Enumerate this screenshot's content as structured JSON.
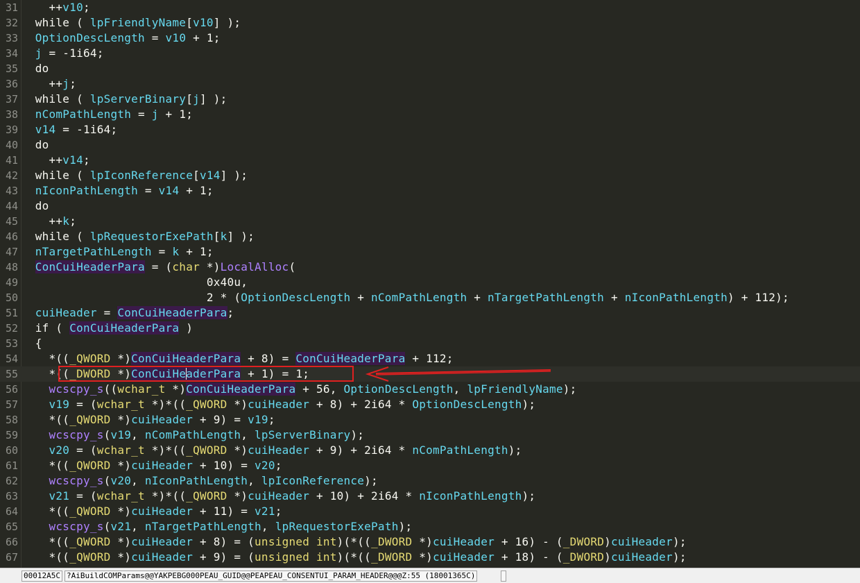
{
  "editor": {
    "lines": [
      {
        "n": "31",
        "tokens": [
          [
            "    ",
            "p"
          ],
          [
            "++",
            "p"
          ],
          [
            "v10",
            "v"
          ],
          [
            ";",
            "p"
          ]
        ]
      },
      {
        "n": "32",
        "tokens": [
          [
            "  while ( ",
            "p"
          ],
          [
            "lpFriendlyName",
            "v"
          ],
          [
            "[",
            "p"
          ],
          [
            "v10",
            "v"
          ],
          [
            "] );",
            "p"
          ]
        ]
      },
      {
        "n": "33",
        "tokens": [
          [
            "  ",
            "p"
          ],
          [
            "OptionDescLength",
            "v"
          ],
          [
            " = ",
            "p"
          ],
          [
            "v10",
            "v"
          ],
          [
            " + 1;",
            "p"
          ]
        ]
      },
      {
        "n": "34",
        "tokens": [
          [
            "  ",
            "p"
          ],
          [
            "j",
            "v"
          ],
          [
            " = -1i64;",
            "p"
          ]
        ]
      },
      {
        "n": "35",
        "tokens": [
          [
            "  do",
            "p"
          ]
        ]
      },
      {
        "n": "36",
        "tokens": [
          [
            "    ++",
            "p"
          ],
          [
            "j",
            "v"
          ],
          [
            ";",
            "p"
          ]
        ]
      },
      {
        "n": "37",
        "tokens": [
          [
            "  while ( ",
            "p"
          ],
          [
            "lpServerBinary",
            "v"
          ],
          [
            "[",
            "p"
          ],
          [
            "j",
            "v"
          ],
          [
            "] );",
            "p"
          ]
        ]
      },
      {
        "n": "38",
        "tokens": [
          [
            "  ",
            "p"
          ],
          [
            "nComPathLength",
            "v"
          ],
          [
            " = ",
            "p"
          ],
          [
            "j",
            "v"
          ],
          [
            " + 1;",
            "p"
          ]
        ]
      },
      {
        "n": "39",
        "tokens": [
          [
            "  ",
            "p"
          ],
          [
            "v14",
            "v"
          ],
          [
            " = -1i64;",
            "p"
          ]
        ]
      },
      {
        "n": "40",
        "tokens": [
          [
            "  do",
            "p"
          ]
        ]
      },
      {
        "n": "41",
        "tokens": [
          [
            "    ++",
            "p"
          ],
          [
            "v14",
            "v"
          ],
          [
            ";",
            "p"
          ]
        ]
      },
      {
        "n": "42",
        "tokens": [
          [
            "  while ( ",
            "p"
          ],
          [
            "lpIconReference",
            "v"
          ],
          [
            "[",
            "p"
          ],
          [
            "v14",
            "v"
          ],
          [
            "] );",
            "p"
          ]
        ]
      },
      {
        "n": "43",
        "tokens": [
          [
            "  ",
            "p"
          ],
          [
            "nIconPathLength",
            "v"
          ],
          [
            " = ",
            "p"
          ],
          [
            "v14",
            "v"
          ],
          [
            " + 1;",
            "p"
          ]
        ]
      },
      {
        "n": "44",
        "tokens": [
          [
            "  do",
            "p"
          ]
        ]
      },
      {
        "n": "45",
        "tokens": [
          [
            "    ++",
            "p"
          ],
          [
            "k",
            "v"
          ],
          [
            ";",
            "p"
          ]
        ]
      },
      {
        "n": "46",
        "tokens": [
          [
            "  while ( ",
            "p"
          ],
          [
            "lpRequestorExePath",
            "v"
          ],
          [
            "[",
            "p"
          ],
          [
            "k",
            "v"
          ],
          [
            "] );",
            "p"
          ]
        ]
      },
      {
        "n": "47",
        "tokens": [
          [
            "  ",
            "p"
          ],
          [
            "nTargetPathLength",
            "v"
          ],
          [
            " = ",
            "p"
          ],
          [
            "k",
            "v"
          ],
          [
            " + 1;",
            "p"
          ]
        ]
      },
      {
        "n": "48",
        "tokens": [
          [
            "  ",
            "p"
          ],
          [
            "ConCuiHeaderPara",
            "g"
          ],
          [
            " = (",
            "p"
          ],
          [
            "char",
            "t"
          ],
          [
            " *)",
            "p"
          ],
          [
            "LocalAlloc",
            "f"
          ],
          [
            "(",
            "p"
          ]
        ]
      },
      {
        "n": "49",
        "tokens": [
          [
            "                           0x40u,",
            "p"
          ]
        ]
      },
      {
        "n": "50",
        "tokens": [
          [
            "                           2 * (",
            "p"
          ],
          [
            "OptionDescLength",
            "v"
          ],
          [
            " + ",
            "p"
          ],
          [
            "nComPathLength",
            "v"
          ],
          [
            " + ",
            "p"
          ],
          [
            "nTargetPathLength",
            "v"
          ],
          [
            " + ",
            "p"
          ],
          [
            "nIconPathLength",
            "v"
          ],
          [
            ") + 112);",
            "p"
          ]
        ]
      },
      {
        "n": "51",
        "tokens": [
          [
            "  ",
            "p"
          ],
          [
            "cuiHeader",
            "v"
          ],
          [
            " = ",
            "p"
          ],
          [
            "ConCuiHeaderPara",
            "g"
          ],
          [
            ";",
            "p"
          ]
        ]
      },
      {
        "n": "52",
        "tokens": [
          [
            "  if ( ",
            "p"
          ],
          [
            "ConCuiHeaderPara",
            "g"
          ],
          [
            " )",
            "p"
          ]
        ]
      },
      {
        "n": "53",
        "tokens": [
          [
            "  {",
            "p"
          ]
        ]
      },
      {
        "n": "54",
        "tokens": [
          [
            "    *((",
            "p"
          ],
          [
            "_QWORD",
            "t"
          ],
          [
            " *)",
            "p"
          ],
          [
            "ConCuiHeaderPara",
            "g"
          ],
          [
            " + 8) = ",
            "p"
          ],
          [
            "ConCuiHeaderPara",
            "g"
          ],
          [
            " + 112;",
            "p"
          ]
        ]
      },
      {
        "n": "55",
        "tokens": [
          [
            "    *((",
            "p"
          ],
          [
            "_DWORD",
            "t"
          ],
          [
            " *)",
            "p"
          ],
          [
            "ConCuiHeaderPara",
            "g"
          ],
          [
            " + 1) = 1;",
            "p"
          ]
        ],
        "cursor": true
      },
      {
        "n": "56",
        "tokens": [
          [
            "    ",
            "p"
          ],
          [
            "wcscpy_s",
            "f"
          ],
          [
            "((",
            "p"
          ],
          [
            "wchar_t",
            "t"
          ],
          [
            " *)",
            "p"
          ],
          [
            "ConCuiHeaderPara",
            "g"
          ],
          [
            " + 56, ",
            "p"
          ],
          [
            "OptionDescLength",
            "v"
          ],
          [
            ", ",
            "p"
          ],
          [
            "lpFriendlyName",
            "v"
          ],
          [
            ");",
            "p"
          ]
        ]
      },
      {
        "n": "57",
        "tokens": [
          [
            "    ",
            "p"
          ],
          [
            "v19",
            "v"
          ],
          [
            " = (",
            "p"
          ],
          [
            "wchar_t",
            "t"
          ],
          [
            " *)*((",
            "p"
          ],
          [
            "_QWORD",
            "t"
          ],
          [
            " *)",
            "p"
          ],
          [
            "cuiHeader",
            "v"
          ],
          [
            " + 8) + 2i64 * ",
            "p"
          ],
          [
            "OptionDescLength",
            "v"
          ],
          [
            ");",
            "p"
          ]
        ]
      },
      {
        "n": "58",
        "tokens": [
          [
            "    *((",
            "p"
          ],
          [
            "_QWORD",
            "t"
          ],
          [
            " *)",
            "p"
          ],
          [
            "cuiHeader",
            "v"
          ],
          [
            " + 9) = ",
            "p"
          ],
          [
            "v19",
            "v"
          ],
          [
            ";",
            "p"
          ]
        ]
      },
      {
        "n": "59",
        "tokens": [
          [
            "    ",
            "p"
          ],
          [
            "wcscpy_s",
            "f"
          ],
          [
            "(",
            "p"
          ],
          [
            "v19",
            "v"
          ],
          [
            ", ",
            "p"
          ],
          [
            "nComPathLength",
            "v"
          ],
          [
            ", ",
            "p"
          ],
          [
            "lpServerBinary",
            "v"
          ],
          [
            ");",
            "p"
          ]
        ]
      },
      {
        "n": "60",
        "tokens": [
          [
            "    ",
            "p"
          ],
          [
            "v20",
            "v"
          ],
          [
            " = (",
            "p"
          ],
          [
            "wchar_t",
            "t"
          ],
          [
            " *)*((",
            "p"
          ],
          [
            "_QWORD",
            "t"
          ],
          [
            " *)",
            "p"
          ],
          [
            "cuiHeader",
            "v"
          ],
          [
            " + 9) + 2i64 * ",
            "p"
          ],
          [
            "nComPathLength",
            "v"
          ],
          [
            ");",
            "p"
          ]
        ]
      },
      {
        "n": "61",
        "tokens": [
          [
            "    *((",
            "p"
          ],
          [
            "_QWORD",
            "t"
          ],
          [
            " *)",
            "p"
          ],
          [
            "cuiHeader",
            "v"
          ],
          [
            " + 10) = ",
            "p"
          ],
          [
            "v20",
            "v"
          ],
          [
            ";",
            "p"
          ]
        ]
      },
      {
        "n": "62",
        "tokens": [
          [
            "    ",
            "p"
          ],
          [
            "wcscpy_s",
            "f"
          ],
          [
            "(",
            "p"
          ],
          [
            "v20",
            "v"
          ],
          [
            ", ",
            "p"
          ],
          [
            "nIconPathLength",
            "v"
          ],
          [
            ", ",
            "p"
          ],
          [
            "lpIconReference",
            "v"
          ],
          [
            ");",
            "p"
          ]
        ]
      },
      {
        "n": "63",
        "tokens": [
          [
            "    ",
            "p"
          ],
          [
            "v21",
            "v"
          ],
          [
            " = (",
            "p"
          ],
          [
            "wchar_t",
            "t"
          ],
          [
            " *)*((",
            "p"
          ],
          [
            "_QWORD",
            "t"
          ],
          [
            " *)",
            "p"
          ],
          [
            "cuiHeader",
            "v"
          ],
          [
            " + 10) + 2i64 * ",
            "p"
          ],
          [
            "nIconPathLength",
            "v"
          ],
          [
            ");",
            "p"
          ]
        ]
      },
      {
        "n": "64",
        "tokens": [
          [
            "    *((",
            "p"
          ],
          [
            "_QWORD",
            "t"
          ],
          [
            " *)",
            "p"
          ],
          [
            "cuiHeader",
            "v"
          ],
          [
            " + 11) = ",
            "p"
          ],
          [
            "v21",
            "v"
          ],
          [
            ";",
            "p"
          ]
        ]
      },
      {
        "n": "65",
        "tokens": [
          [
            "    ",
            "p"
          ],
          [
            "wcscpy_s",
            "f"
          ],
          [
            "(",
            "p"
          ],
          [
            "v21",
            "v"
          ],
          [
            ", ",
            "p"
          ],
          [
            "nTargetPathLength",
            "v"
          ],
          [
            ", ",
            "p"
          ],
          [
            "lpRequestorExePath",
            "v"
          ],
          [
            ");",
            "p"
          ]
        ]
      },
      {
        "n": "66",
        "tokens": [
          [
            "    *((",
            "p"
          ],
          [
            "_QWORD",
            "t"
          ],
          [
            " *)",
            "p"
          ],
          [
            "cuiHeader",
            "v"
          ],
          [
            " + 8) = (",
            "p"
          ],
          [
            "unsigned int",
            "t"
          ],
          [
            ")(*((",
            "p"
          ],
          [
            "_DWORD",
            "t"
          ],
          [
            " *)",
            "p"
          ],
          [
            "cuiHeader",
            "v"
          ],
          [
            " + 16) - (",
            "p"
          ],
          [
            "_DWORD",
            "t"
          ],
          [
            ")",
            "p"
          ],
          [
            "cuiHeader",
            "v"
          ],
          [
            ");",
            "p"
          ]
        ]
      },
      {
        "n": "67",
        "tokens": [
          [
            "    *((",
            "p"
          ],
          [
            "_QWORD",
            "t"
          ],
          [
            " *)",
            "p"
          ],
          [
            "cuiHeader",
            "v"
          ],
          [
            " + 9) = (",
            "p"
          ],
          [
            "unsigned int",
            "t"
          ],
          [
            ")(*((",
            "p"
          ],
          [
            "_DWORD",
            "t"
          ],
          [
            " *)",
            "p"
          ],
          [
            "cuiHeader",
            "v"
          ],
          [
            " + 18) - (",
            "p"
          ],
          [
            "_DWORD",
            "t"
          ],
          [
            ")",
            "p"
          ],
          [
            "cuiHeader",
            "v"
          ],
          [
            ");",
            "p"
          ]
        ]
      }
    ]
  },
  "statusbar": {
    "address": "00012A5C",
    "location": "?AiBuildCOMParams@@YAKPEBG000PEAU_GUID@@PEAPEAU_CONSENTUI_PARAM_HEADER@@@Z:55 (18001365C)"
  },
  "colors": {
    "background": "#272822",
    "plain": "#f8f8f2",
    "variable": "#66d9ef",
    "global_bg": "#3b1a4a",
    "function": "#ae81ff",
    "type": "#e6db74",
    "annotation_red": "#e02020"
  }
}
